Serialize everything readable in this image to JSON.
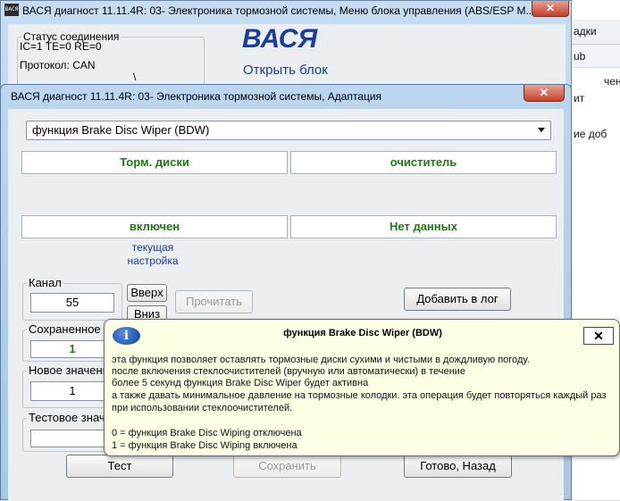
{
  "background_app": {
    "fragments": [
      "адки",
      "ub",
      "чено",
      "ит",
      "ие доб"
    ]
  },
  "main_window": {
    "icon_text": "ВАСЯ",
    "title": "ВАСЯ диагност 11.11.4R: 03- Электроника тормозной системы,  Меню блока управления (ABS/ESP M...",
    "close": "✕",
    "status_group": {
      "legend": "Статус соединения",
      "line1": "IC=1  TE=0   RE=0",
      "line2": "Протокол: CAN"
    },
    "brand": "ВАСЯ",
    "open_block": "Открыть блок",
    "slash": "\\"
  },
  "adapt_window": {
    "title": "ВАСЯ диагност 11.11.4R: 03- Электроника тормозной системы, Адаптация",
    "close": "✕",
    "function_select": "функция Brake Disc Wiper (BDW)",
    "values": {
      "top_left": "Торм. диски",
      "top_right": "очиститель",
      "bottom_left": "включен",
      "bottom_right": "Нет данных"
    },
    "current_setting_note": [
      "текущая",
      "настройка"
    ],
    "channel": {
      "legend": "Канал",
      "value": "55"
    },
    "saved": {
      "legend": "Сохраненное з",
      "value": "1"
    },
    "new_value": {
      "legend": "Новое значени",
      "value": "1"
    },
    "test_value": {
      "legend": "Тестовое знач",
      "value": ""
    },
    "buttons": {
      "up": "Вверх",
      "down": "Вниз",
      "read": "Прочитать",
      "add_log": "Добавить в лог",
      "test": "Тест",
      "save": "Сохранить",
      "done_back": "Готово, Назад"
    }
  },
  "tooltip": {
    "icon": "i",
    "title": "функция Brake Disc Wiper (BDW)",
    "close": "✕",
    "lines": [
      "эта функция позволяет оставлять тормозные диски сухими и чистыми в дождливую погоду.",
      "после включения стеклоочистителей (вручную или автоматически) в течение",
      " более 5 секунд функция Brake Disc Wiper будет активна",
      "а также давать минимальное давление на тормозные колодки. эта операция будет повторяться каждый раз",
      "при использовании стеклоочистителей.",
      "0 = функция Brake Disc Wiping отключена",
      "1 = функция Brake Disc Wiping включена"
    ]
  }
}
